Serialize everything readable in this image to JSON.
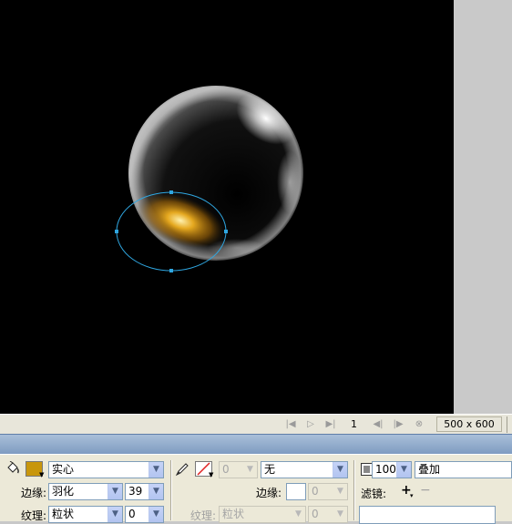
{
  "colors": {
    "canvas": "#000000",
    "selection_ellipse": "#2fa6e0",
    "fill_color": "#c8960c",
    "panel_bg": "#ece9d8"
  },
  "status_bar": {
    "frame_number": "1",
    "doc_size": "500 x 600"
  },
  "properties": {
    "fill": {
      "type": "实心",
      "edge_label": "边缘:",
      "edge_value": "羽化",
      "edge_amount": "39",
      "texture_label": "纹理:",
      "texture_value": "粒状",
      "texture_amount": "0"
    },
    "stroke": {
      "width": "0",
      "type": "无",
      "edge_label": "边缘:",
      "edge_amount": "0",
      "texture_label": "纹理:",
      "texture_value": "粒状",
      "texture_amount": "0"
    },
    "effects": {
      "opacity": "100",
      "blend_mode": "叠加",
      "filters_label": "滤镜:",
      "add_icon": "plus-icon",
      "remove_icon": "minus-icon"
    }
  }
}
